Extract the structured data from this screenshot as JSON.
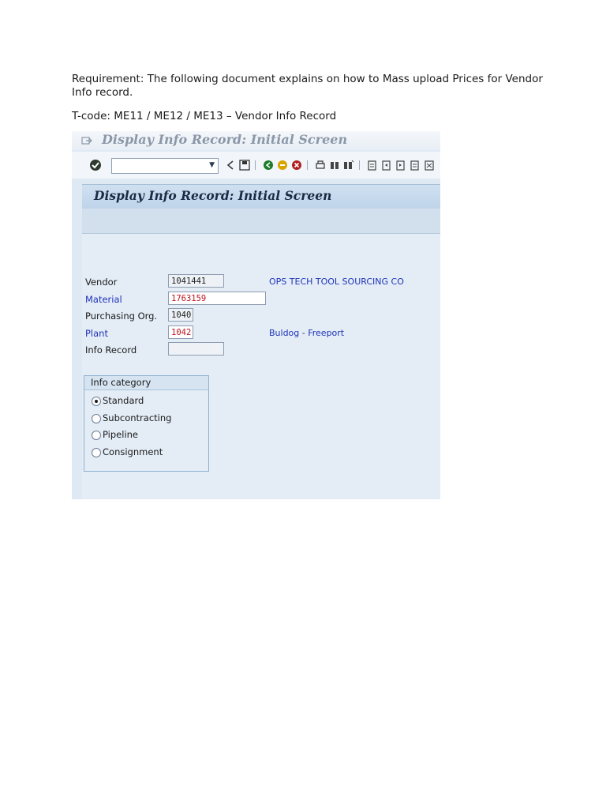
{
  "document": {
    "requirement": "Requirement: The following document explains on how to Mass upload Prices for Vendor Info record.",
    "tcode": "T-code: ME11 / ME12 / ME13 – Vendor Info Record"
  },
  "sap_window": {
    "title": "Display Info Record: Initial Screen",
    "toolbar": {
      "command_field_value": "",
      "icons": [
        "enter-icon",
        "back-arrow-icon",
        "save-icon",
        "back-icon",
        "exit-icon",
        "cancel-icon",
        "print-icon",
        "find-icon",
        "find-next-icon",
        "first-page-icon",
        "previous-page-icon",
        "next-page-icon",
        "last-page-icon"
      ]
    },
    "panel_title": "Display Info Record: Initial Screen",
    "fields": {
      "vendor": {
        "label": "Vendor",
        "value": "1041441",
        "description": "OPS TECH TOOL SOURCING CO"
      },
      "material": {
        "label": "Material",
        "value": "1763159"
      },
      "purchasing_org": {
        "label": "Purchasing Org.",
        "value": "1040"
      },
      "plant": {
        "label": "Plant",
        "value": "1042",
        "description": "Buldog - Freeport"
      },
      "info_record": {
        "label": "Info Record",
        "value": ""
      }
    },
    "info_category": {
      "title": "Info category",
      "options": [
        {
          "label": "Standard",
          "selected": true
        },
        {
          "label": "Subcontracting",
          "selected": false
        },
        {
          "label": "Pipeline",
          "selected": false
        },
        {
          "label": "Consignment",
          "selected": false
        }
      ]
    },
    "colors": {
      "required_label": "#1e33b8",
      "error_value": "#c0141c",
      "background": "#dfe9f3"
    }
  }
}
